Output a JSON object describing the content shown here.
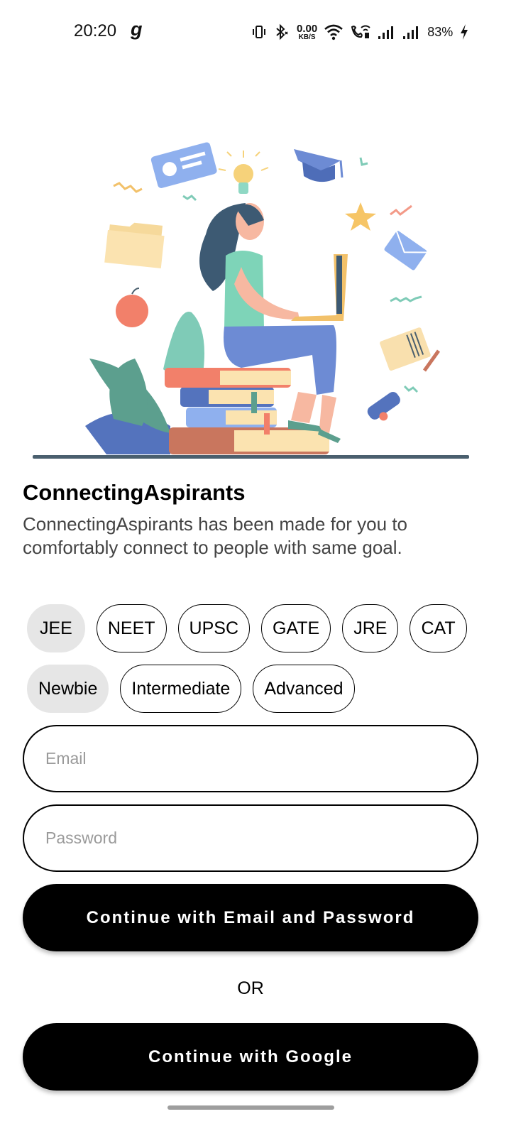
{
  "status_bar": {
    "time": "20:20",
    "app_glyph": "g",
    "net_speed_value": "0.00",
    "net_speed_unit": "KB/S",
    "battery": "83%",
    "icons": [
      "vibrate-icon",
      "bluetooth-icon",
      "wifi-icon",
      "wifi-calling-icon",
      "signal-icon",
      "signal-icon",
      "charging-icon"
    ]
  },
  "app": {
    "title": "ConnectingAspirants",
    "description": "ConnectingAspirants has been made for you to comfortably connect to people with same goal."
  },
  "exam_chips": [
    {
      "label": "JEE",
      "selected": true
    },
    {
      "label": "NEET",
      "selected": false
    },
    {
      "label": "UPSC",
      "selected": false
    },
    {
      "label": "GATE",
      "selected": false
    },
    {
      "label": "JRE",
      "selected": false
    },
    {
      "label": "CAT",
      "selected": false
    }
  ],
  "level_chips": [
    {
      "label": "Newbie",
      "selected": true
    },
    {
      "label": "Intermediate",
      "selected": false
    },
    {
      "label": "Advanced",
      "selected": false
    }
  ],
  "form": {
    "email_placeholder": "Email",
    "email_value": "",
    "password_placeholder": "Password",
    "password_value": ""
  },
  "actions": {
    "email_button": "Continue with Email and Password",
    "or_text": "OR",
    "google_button": "Continue with Google"
  },
  "colors": {
    "primary": "#000000",
    "chip_selected_bg": "#e6e6e6",
    "placeholder": "#9a9a9a",
    "description": "#444444"
  }
}
